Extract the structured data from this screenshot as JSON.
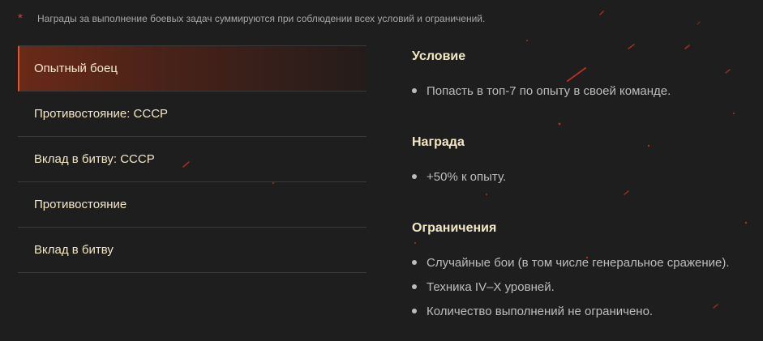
{
  "note": {
    "marker": "*",
    "text": "Награды за выполнение боевых задач суммируются при соблюдении всех условий и ограничений."
  },
  "menu": {
    "items": [
      {
        "label": "Опытный боец",
        "active": true
      },
      {
        "label": "Противостояние: СССР",
        "active": false
      },
      {
        "label": "Вклад в битву: СССР",
        "active": false
      },
      {
        "label": "Противостояние",
        "active": false
      },
      {
        "label": "Вклад в битву",
        "active": false
      }
    ]
  },
  "details": {
    "condition": {
      "title": "Условие",
      "items": [
        "Попасть в топ-7 по опыту в своей команде."
      ]
    },
    "reward": {
      "title": "Награда",
      "items": [
        "+50% к опыту."
      ]
    },
    "restrictions": {
      "title": "Ограничения",
      "items": [
        "Случайные бои (в том числе генеральное сражение).",
        "Техника IV–X уровней.",
        "Количество выполнений не ограничено."
      ]
    }
  },
  "colors": {
    "background": "#1e1e1e",
    "accent": "#e2542c",
    "title_text": "#f3e7c4",
    "body_text": "#bdbdbd"
  }
}
